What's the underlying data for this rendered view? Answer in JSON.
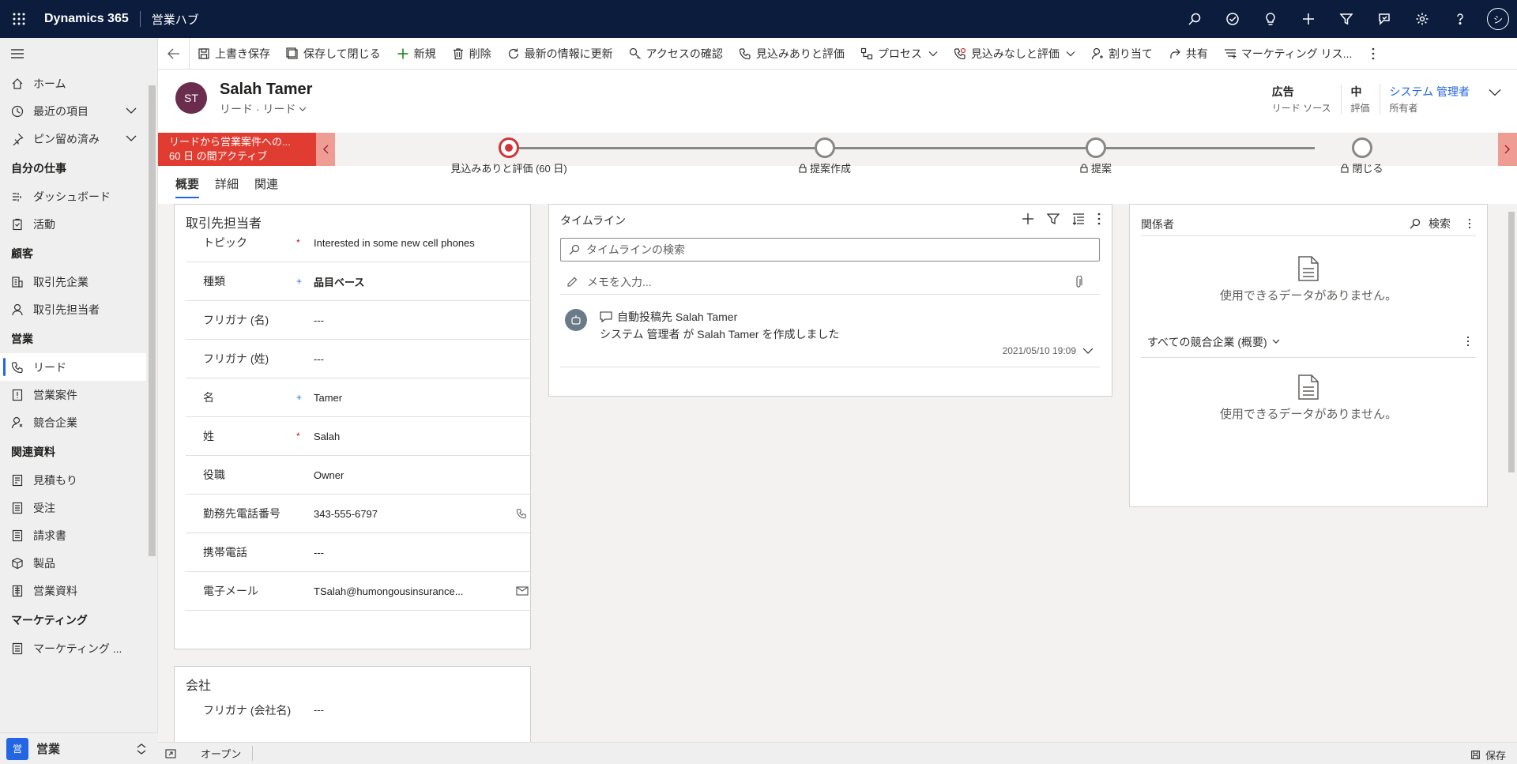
{
  "topbar": {
    "brand": "Dynamics 365",
    "app_name": "営業ハブ",
    "avatar_initial": "シ",
    "icons": [
      "search-icon",
      "target-icon",
      "lightbulb-icon",
      "plus-icon",
      "filter-icon",
      "assistant-icon",
      "gear-icon",
      "help-icon"
    ],
    "background": "#0b1c3d"
  },
  "command_bar": {
    "items": [
      {
        "label": "上書き保存",
        "icon": "save-icon"
      },
      {
        "label": "保存して閉じる",
        "icon": "save-close-icon"
      },
      {
        "label": "新規",
        "icon": "plus-icon"
      },
      {
        "label": "削除",
        "icon": "trash-icon"
      },
      {
        "label": "最新の情報に更新",
        "icon": "refresh-icon"
      },
      {
        "label": "アクセスの確認",
        "icon": "key-icon"
      },
      {
        "label": "見込みありと評価",
        "icon": "phone-check-icon"
      },
      {
        "label": "プロセス",
        "icon": "process-icon"
      },
      {
        "label": "見込みなしと評価",
        "icon": "phone-x-icon"
      },
      {
        "label": "割り当て",
        "icon": "person-icon"
      },
      {
        "label": "共有",
        "icon": "share-icon"
      },
      {
        "label": "マーケティング リス...",
        "icon": "list-icon"
      }
    ]
  },
  "sidebar": {
    "top": [
      {
        "label": "ホーム",
        "icon": "home-icon"
      },
      {
        "label": "最近の項目",
        "icon": "clock-icon"
      },
      {
        "label": "ピン留め済み",
        "icon": "pin-icon"
      }
    ],
    "groups": [
      {
        "title": "自分の仕事",
        "items": [
          {
            "label": "ダッシュボード",
            "icon": "dashboard-icon"
          },
          {
            "label": "活動",
            "icon": "clipboard-icon"
          }
        ]
      },
      {
        "title": "顧客",
        "items": [
          {
            "label": "取引先企業",
            "icon": "building-icon"
          },
          {
            "label": "取引先担当者",
            "icon": "person-icon"
          }
        ]
      },
      {
        "title": "営業",
        "items": [
          {
            "label": "リード",
            "icon": "phone-icon"
          },
          {
            "label": "営業案件",
            "icon": "opportunity-icon"
          },
          {
            "label": "競合企業",
            "icon": "competitor-icon"
          }
        ]
      },
      {
        "title": "関連資料",
        "items": [
          {
            "label": "見積もり",
            "icon": "quote-icon"
          },
          {
            "label": "受注",
            "icon": "order-icon"
          },
          {
            "label": "請求書",
            "icon": "invoice-icon"
          },
          {
            "label": "製品",
            "icon": "box-icon"
          },
          {
            "label": "営業資料",
            "icon": "document-icon"
          }
        ]
      },
      {
        "title": "マーケティング",
        "items": [
          {
            "label": "マーケティング ...",
            "icon": "marketing-list-icon"
          }
        ]
      }
    ],
    "area_badge": "営",
    "area_label": "営業"
  },
  "record": {
    "initials": "ST",
    "name": "Salah Tamer",
    "entity": "リード",
    "form": "リード",
    "header_fields": [
      {
        "value": "広告",
        "label": "リード ソース"
      },
      {
        "value": "中",
        "label": "評価"
      },
      {
        "value": "システム 管理者",
        "label": "所有者"
      }
    ],
    "avatar_color": "#6b2d4e"
  },
  "bpf": {
    "active_title": "リードから営業案件への...",
    "active_duration": "60 日 の間アクティブ",
    "stages": [
      {
        "label": "見込みありと評価 (60 日)",
        "locked": false
      },
      {
        "label": "提案作成",
        "locked": true
      },
      {
        "label": "提案",
        "locked": true
      },
      {
        "label": "閉じる",
        "locked": true
      }
    ],
    "active_color": "#e03c31"
  },
  "tabs": [
    "概要",
    "詳細",
    "関連"
  ],
  "contact_section": {
    "title": "取引先担当者",
    "fields": [
      {
        "label": "トピック",
        "req": "*",
        "value": "Interested in some new cell phones"
      },
      {
        "label": "種類",
        "req": "+",
        "value": "品目ベース"
      },
      {
        "label": "フリガナ (名)",
        "req": "",
        "value": "---"
      },
      {
        "label": "フリガナ (姓)",
        "req": "",
        "value": "---"
      },
      {
        "label": "名",
        "req": "+",
        "value": "Tamer"
      },
      {
        "label": "姓",
        "req": "*",
        "value": "Salah"
      },
      {
        "label": "役職",
        "req": "",
        "value": "Owner"
      },
      {
        "label": "勤務先電話番号",
        "req": "",
        "value": "343-555-6797"
      },
      {
        "label": "携帯電話",
        "req": "",
        "value": "---"
      },
      {
        "label": "電子メール",
        "req": "",
        "value": "TSalah@humongousinsurance..."
      }
    ]
  },
  "company_section": {
    "title": "会社",
    "fields": [
      {
        "label": "フリガナ (会社名)",
        "value": "---"
      }
    ]
  },
  "timeline": {
    "title": "タイムライン",
    "search_placeholder": "タイムラインの検索",
    "note_placeholder": "メモを入力...",
    "post": {
      "title": "自動投稿先 Salah Tamer",
      "text": "システム 管理者 が Salah Tamer を作成しました",
      "time": "2021/05/10 19:09"
    }
  },
  "stakeholders": {
    "title": "関係者",
    "search_label": "検索",
    "empty_text": "使用できるデータがありません。",
    "competitors_view": "すべての競合企業 (概要)",
    "empty_text_2": "使用できるデータがありません。"
  },
  "statusbar": {
    "status": "オープン",
    "save_label": "保存"
  }
}
